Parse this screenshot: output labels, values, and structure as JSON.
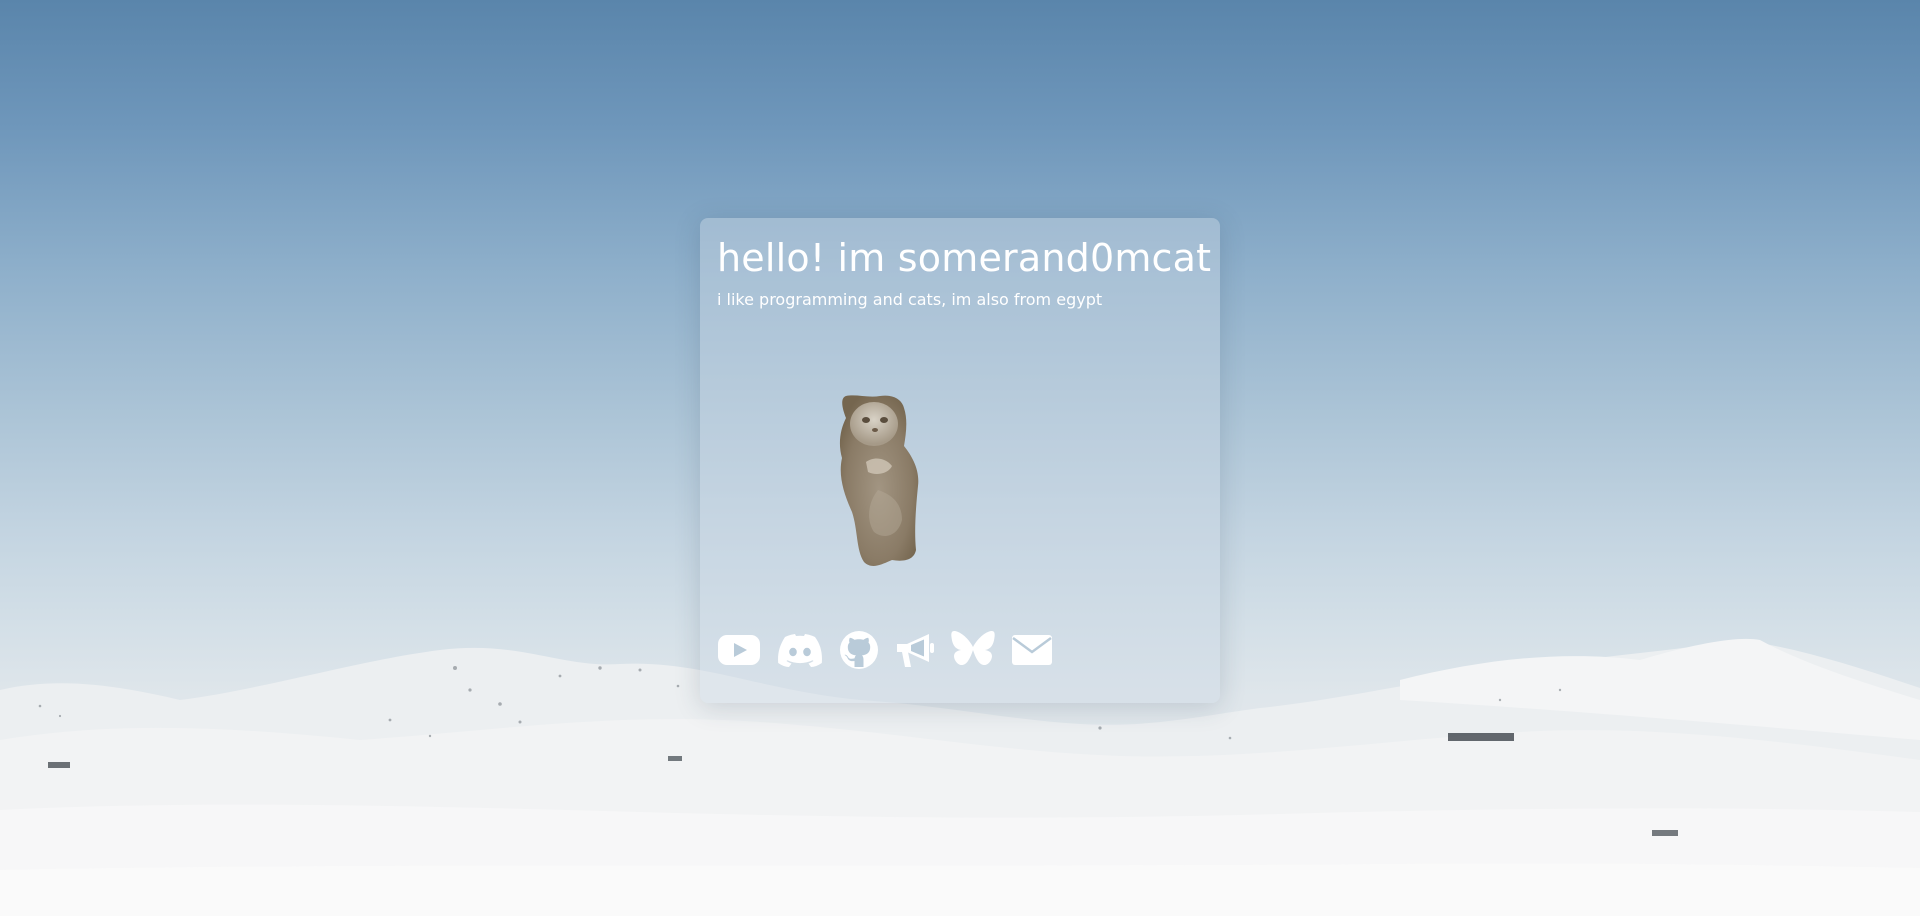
{
  "profile": {
    "title": "hello! im somerand0mcat",
    "subtitle": "i like programming and cats, im also from egypt"
  },
  "avatar": {
    "icon": "cat-image"
  },
  "socials": [
    {
      "icon": "youtube-icon"
    },
    {
      "icon": "discord-icon"
    },
    {
      "icon": "github-icon"
    },
    {
      "icon": "megaphone-icon"
    },
    {
      "icon": "bluesky-icon"
    },
    {
      "icon": "envelope-icon"
    }
  ],
  "colors": {
    "sky_top": "#5a85ab",
    "sky_bottom": "#e9ecee",
    "text": "#ffffff"
  }
}
